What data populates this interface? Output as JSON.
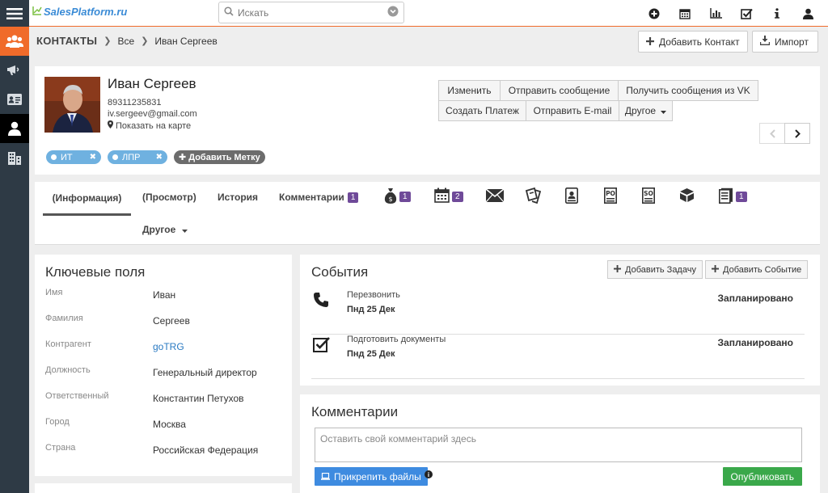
{
  "app": {
    "logo": "SalesPlatform.ru"
  },
  "search": {
    "placeholder": "Искать"
  },
  "header": {
    "module": "КОНТАКТЫ",
    "crumb_all": "Все",
    "crumb_current": "Иван Сергеев",
    "add_contact": "Добавить Контакт",
    "import": "Импорт"
  },
  "profile": {
    "name": "Иван Сергеев",
    "phone": "89311235831",
    "email": "iv.sergeev@gmail.com",
    "map_link": "Показать на карте",
    "tags": [
      "ИТ",
      "ЛПР"
    ],
    "add_tag": "Добавить Метку",
    "actions_row1": [
      "Изменить",
      "Отправить сообщение",
      "Получить сообщения из VK"
    ],
    "actions_row2": [
      "Создать Платеж",
      "Отправить E-mail",
      "Другое"
    ]
  },
  "tabs": {
    "info": "(Информация)",
    "view": "(Просмотр)",
    "history": "История",
    "comments": "Комментарии",
    "comments_count": "1",
    "money_count": "1",
    "calendar_count": "2",
    "docs_count": "1",
    "other": "Другое"
  },
  "keyfields": {
    "title": "Ключевые поля",
    "rows": [
      {
        "label": "Имя",
        "value": "Иван"
      },
      {
        "label": "Фамилия",
        "value": "Сергеев"
      },
      {
        "label": "Контрагент",
        "value": "goTRG"
      },
      {
        "label": "Должность",
        "value": "Генеральный директор"
      },
      {
        "label": "Ответственный",
        "value": "Константин Петухов"
      },
      {
        "label": "Город",
        "value": "Москва"
      },
      {
        "label": "Страна",
        "value": "Российская Федерация"
      }
    ]
  },
  "events": {
    "title": "События",
    "add_task": "Добавить Задачу",
    "add_event": "Добавить Событие",
    "items": [
      {
        "name": "Перезвонить",
        "date": "Пнд 25 Дек",
        "status": "Запланировано",
        "icon": "phone-icon"
      },
      {
        "name": "Подготовить документы",
        "date": "Пнд 25 Дек",
        "status": "Запланировано",
        "icon": "checkbox-icon"
      }
    ]
  },
  "comments": {
    "title": "Комментарии",
    "placeholder": "Оставить свой комментарий здесь",
    "attach": "Прикрепить файлы",
    "publish": "Опубликовать"
  },
  "colors": {
    "accent": "#f06b2a",
    "sidebar": "#2e3a45",
    "tag": "#6fb1e0",
    "badge": "#6f4a99",
    "primary": "#3e8be0",
    "success": "#3aa84a"
  }
}
